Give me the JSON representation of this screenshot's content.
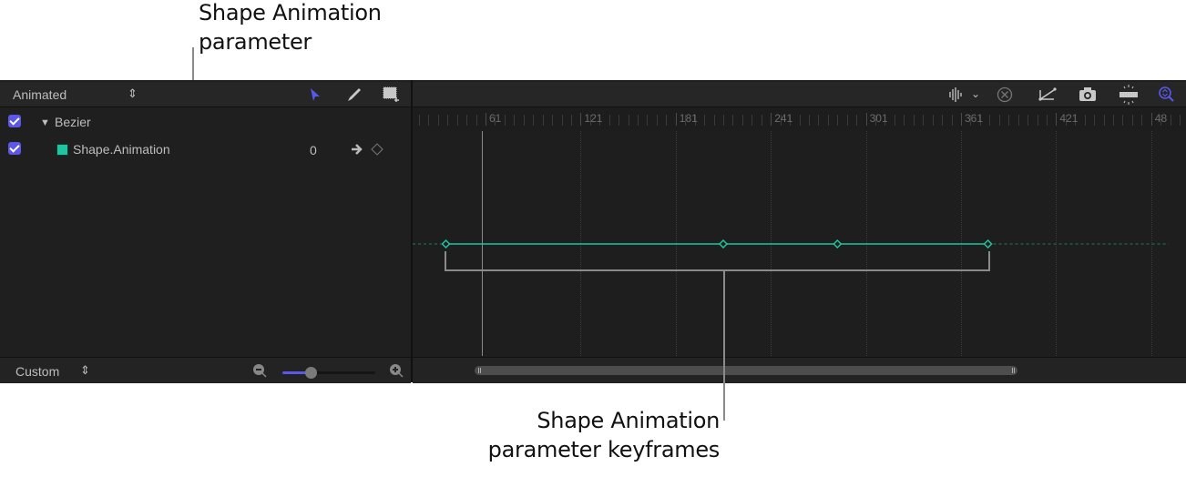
{
  "callouts": {
    "parameter": [
      "Shape Animation",
      "parameter"
    ],
    "keyframes": [
      "Shape Animation",
      "parameter keyframes"
    ]
  },
  "left_header": {
    "filter_popup": "Animated",
    "tools": [
      "select-arrow",
      "pen",
      "marquee-select"
    ],
    "active_tool_color": "#5b57e8"
  },
  "tree": {
    "group": {
      "label": "Bezier",
      "checked": true,
      "expanded": true
    },
    "parameter": {
      "label": "Shape.Animation",
      "value": "0",
      "checked": true,
      "swatch_color": "#1fc4a0"
    }
  },
  "right_header": {
    "icons": [
      "audio-waveform",
      "chevron-down",
      "clear-x-circle",
      "curve-fit",
      "snapshot-camera",
      "fit-to-window",
      "zoom-magnifier"
    ]
  },
  "ruler": {
    "labels": [
      "61",
      "121",
      "181",
      "241",
      "301",
      "361",
      "421",
      "48"
    ]
  },
  "curve": {
    "color": "#1fc4a0",
    "keyframes_frame": [
      36,
      211,
      283,
      378
    ]
  },
  "footer": {
    "preset_popup": "Custom",
    "zoom_slider_fraction": 0.3
  },
  "colors": {
    "accent": "#5b57e8",
    "curve": "#1fc4a0"
  }
}
